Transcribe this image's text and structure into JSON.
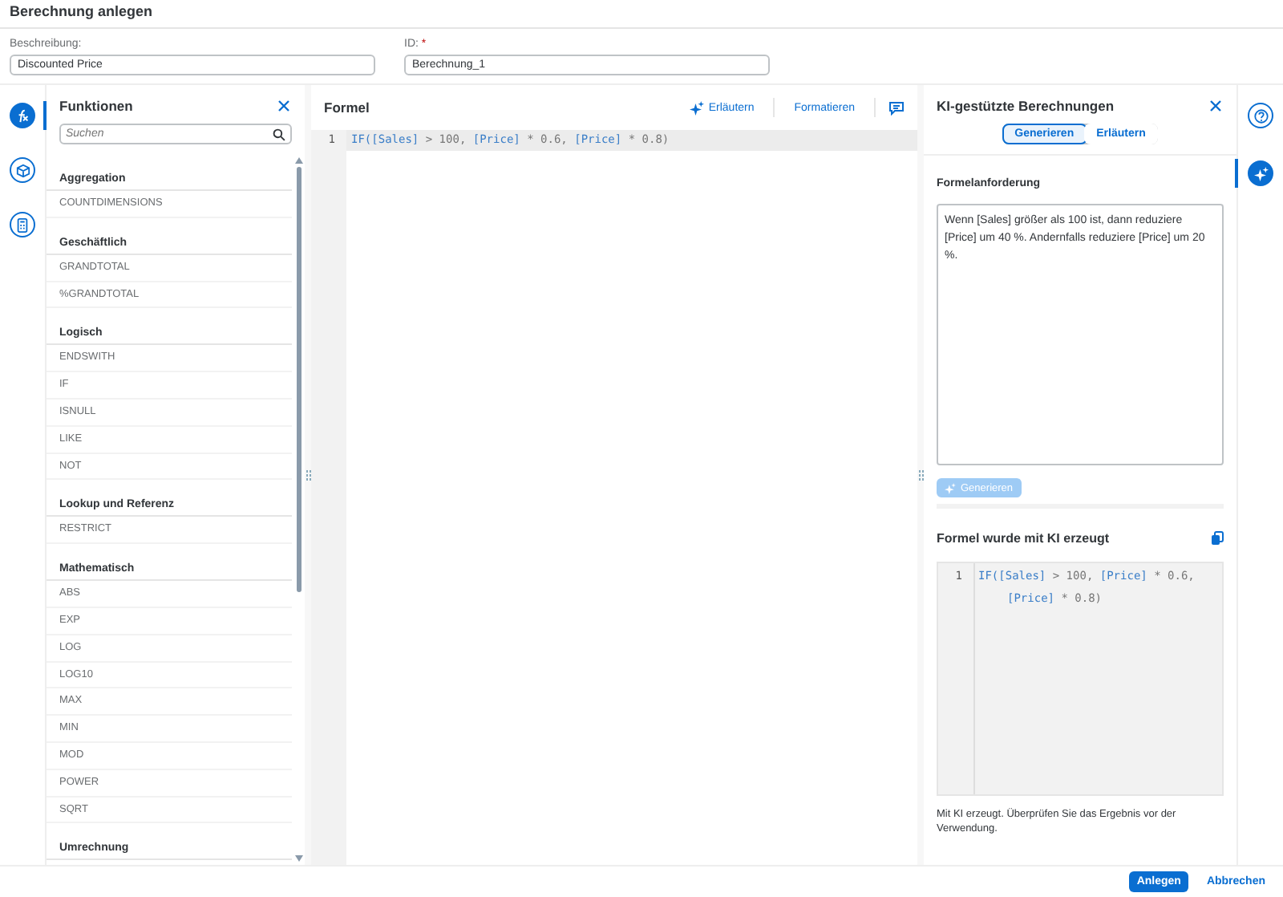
{
  "window": {
    "title": "Berechnung anlegen"
  },
  "fields": [
    {
      "label": "Beschreibung:",
      "value": "Discounted Price"
    },
    {
      "label": "ID:",
      "value": "Berechnung_1",
      "required_mark": "*"
    }
  ],
  "left_rail": [
    {
      "kind": "function",
      "selected": true
    },
    {
      "kind": "cube",
      "selected": false
    },
    {
      "kind": "calculator",
      "selected": false
    }
  ],
  "functions": {
    "title": "Funktionen",
    "search": {
      "placeholder": "Suchen"
    },
    "groups": [
      {
        "name": "Aggregation",
        "items": [
          "COUNTDIMENSIONS"
        ]
      },
      {
        "name": "Geschäftlich",
        "items": [
          "GRANDTOTAL",
          "%GRANDTOTAL"
        ]
      },
      {
        "name": "Logisch",
        "items": [
          "ENDSWITH",
          "IF",
          "ISNULL",
          "LIKE",
          "NOT"
        ]
      },
      {
        "name": "Lookup und Referenz",
        "items": [
          "RESTRICT"
        ]
      },
      {
        "name": "Mathematisch",
        "items": [
          "ABS",
          "EXP",
          "LOG",
          "LOG10",
          "MAX",
          "MIN",
          "MOD",
          "POWER",
          "SQRT"
        ]
      },
      {
        "name": "Umrechnung"
      }
    ]
  },
  "editor": {
    "title": "Formel",
    "actions": [
      {
        "kind": "sparkle",
        "label": "Erläutern"
      },
      {
        "kind": "plain",
        "label": "Formatieren"
      }
    ],
    "lines": [
      {
        "number": "1",
        "tokens": [
          {
            "kind": "field",
            "text": "IF([Sales]"
          },
          {
            "kind": "op",
            "text": " > 100, "
          },
          {
            "kind": "field",
            "text": "[Price]"
          },
          {
            "kind": "op",
            "text": " * 0.6, "
          },
          {
            "kind": "field",
            "text": "[Price]"
          },
          {
            "kind": "op",
            "text": " * 0.8)"
          }
        ]
      }
    ]
  },
  "ai_panel": {
    "title": "KI-gestützte Berechnungen",
    "tabs": [
      {
        "label": "Generieren",
        "selected": true
      },
      {
        "label": "Erläutern",
        "selected": false
      }
    ],
    "request_label": "Formelanforderung",
    "request": "Wenn [Sales] größer als 100 ist, dann reduziere [Price] um 40 %. Andernfalls reduziere [Price] um 20 %.",
    "generate_button": {
      "label": "Generieren",
      "disabled": true
    },
    "result_title": "Formel wurde mit KI erzeugt",
    "result_lines": [
      {
        "number": "1",
        "tokens": [
          {
            "kind": "field",
            "text": "IF([Sales]"
          },
          {
            "kind": "op",
            "text": " > 100, "
          },
          {
            "kind": "field",
            "text": "[Price]"
          },
          {
            "kind": "op",
            "text": " * 0.6,"
          }
        ]
      },
      {
        "tokens": [
          {
            "kind": "field",
            "text": "[Price]"
          },
          {
            "kind": "op",
            "text": " * 0.8)"
          }
        ]
      }
    ],
    "note": "Mit KI erzeugt. Überprüfen Sie das Ergebnis vor der Verwendung."
  },
  "right_rail": [
    {
      "kind": "help",
      "selected": false
    },
    {
      "kind": "sparkle",
      "selected": true
    }
  ],
  "footer": {
    "buttons": [
      {
        "label": "Anlegen",
        "kind": "primary"
      },
      {
        "label": "Abbrechen",
        "kind": "transparent"
      }
    ]
  }
}
